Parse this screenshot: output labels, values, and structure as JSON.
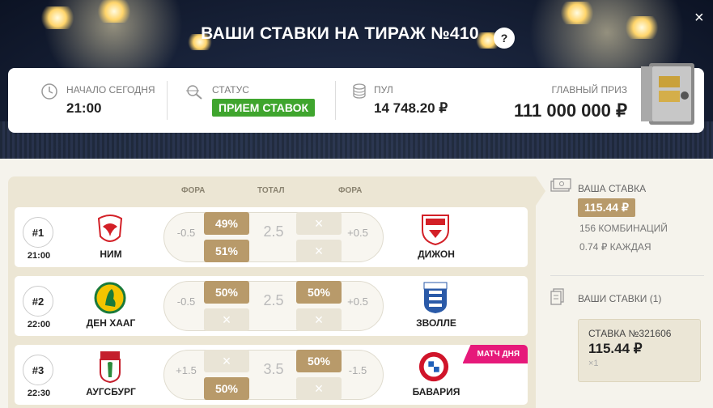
{
  "header": {
    "title": "ВАШИ СТАВКИ НА ТИРАЖ №410",
    "help_label": "?",
    "close_label": "×"
  },
  "info": {
    "start_label": "НАЧАЛО СЕГОДНЯ",
    "start_value": "21:00",
    "status_label": "СТАТУС",
    "status_value": "ПРИЕМ СТАВОК",
    "pool_label": "ПУЛ",
    "pool_value": "14 748.20 ₽",
    "prize_label": "ГЛАВНЫЙ ПРИЗ",
    "prize_value": "111 000 000 ₽"
  },
  "columns": {
    "fora_left": "ФОРА",
    "total": "ТОТАЛ",
    "fora_right": "ФОРА"
  },
  "matches": [
    {
      "num": "#1",
      "time": "21:00",
      "home": "НИМ",
      "away": "ДИЖОН",
      "home_hcap": "-0.5",
      "total": "2.5",
      "away_hcap": "+0.5",
      "home_top": "49%",
      "home_bottom": "51%",
      "away_top": "×",
      "away_bottom": "×",
      "badge": ""
    },
    {
      "num": "#2",
      "time": "22:00",
      "home": "ДЕН ХААГ",
      "away": "ЗВОЛЛЕ",
      "home_hcap": "-0.5",
      "total": "2.5",
      "away_hcap": "+0.5",
      "home_top": "50%",
      "home_bottom": "×",
      "away_top": "50%",
      "away_bottom": "×",
      "badge": ""
    },
    {
      "num": "#3",
      "time": "22:30",
      "home": "АУГСБУРГ",
      "away": "БАВАРИЯ",
      "home_hcap": "+1.5",
      "total": "3.5",
      "away_hcap": "-1.5",
      "home_top": "×",
      "home_bottom": "50%",
      "away_top": "50%",
      "away_bottom": "×",
      "badge": "МАТЧ ДНЯ"
    }
  ],
  "side": {
    "your_stake_label": "ВАША СТАВКА",
    "your_stake_value": "115.44 ₽",
    "combinations": "156 КОМБИНАЦИЙ",
    "each": "0.74 ₽ КАЖДАЯ",
    "your_bets_label": "ВАШИ СТАВКИ (1)",
    "ticket_label": "СТАВКА №321606",
    "ticket_amount": "115.44 ₽",
    "ticket_mult": "×1"
  },
  "colors": {
    "accent_gold": "#b89a6a",
    "status_green": "#3fa52e",
    "day_badge": "#e6197a"
  }
}
